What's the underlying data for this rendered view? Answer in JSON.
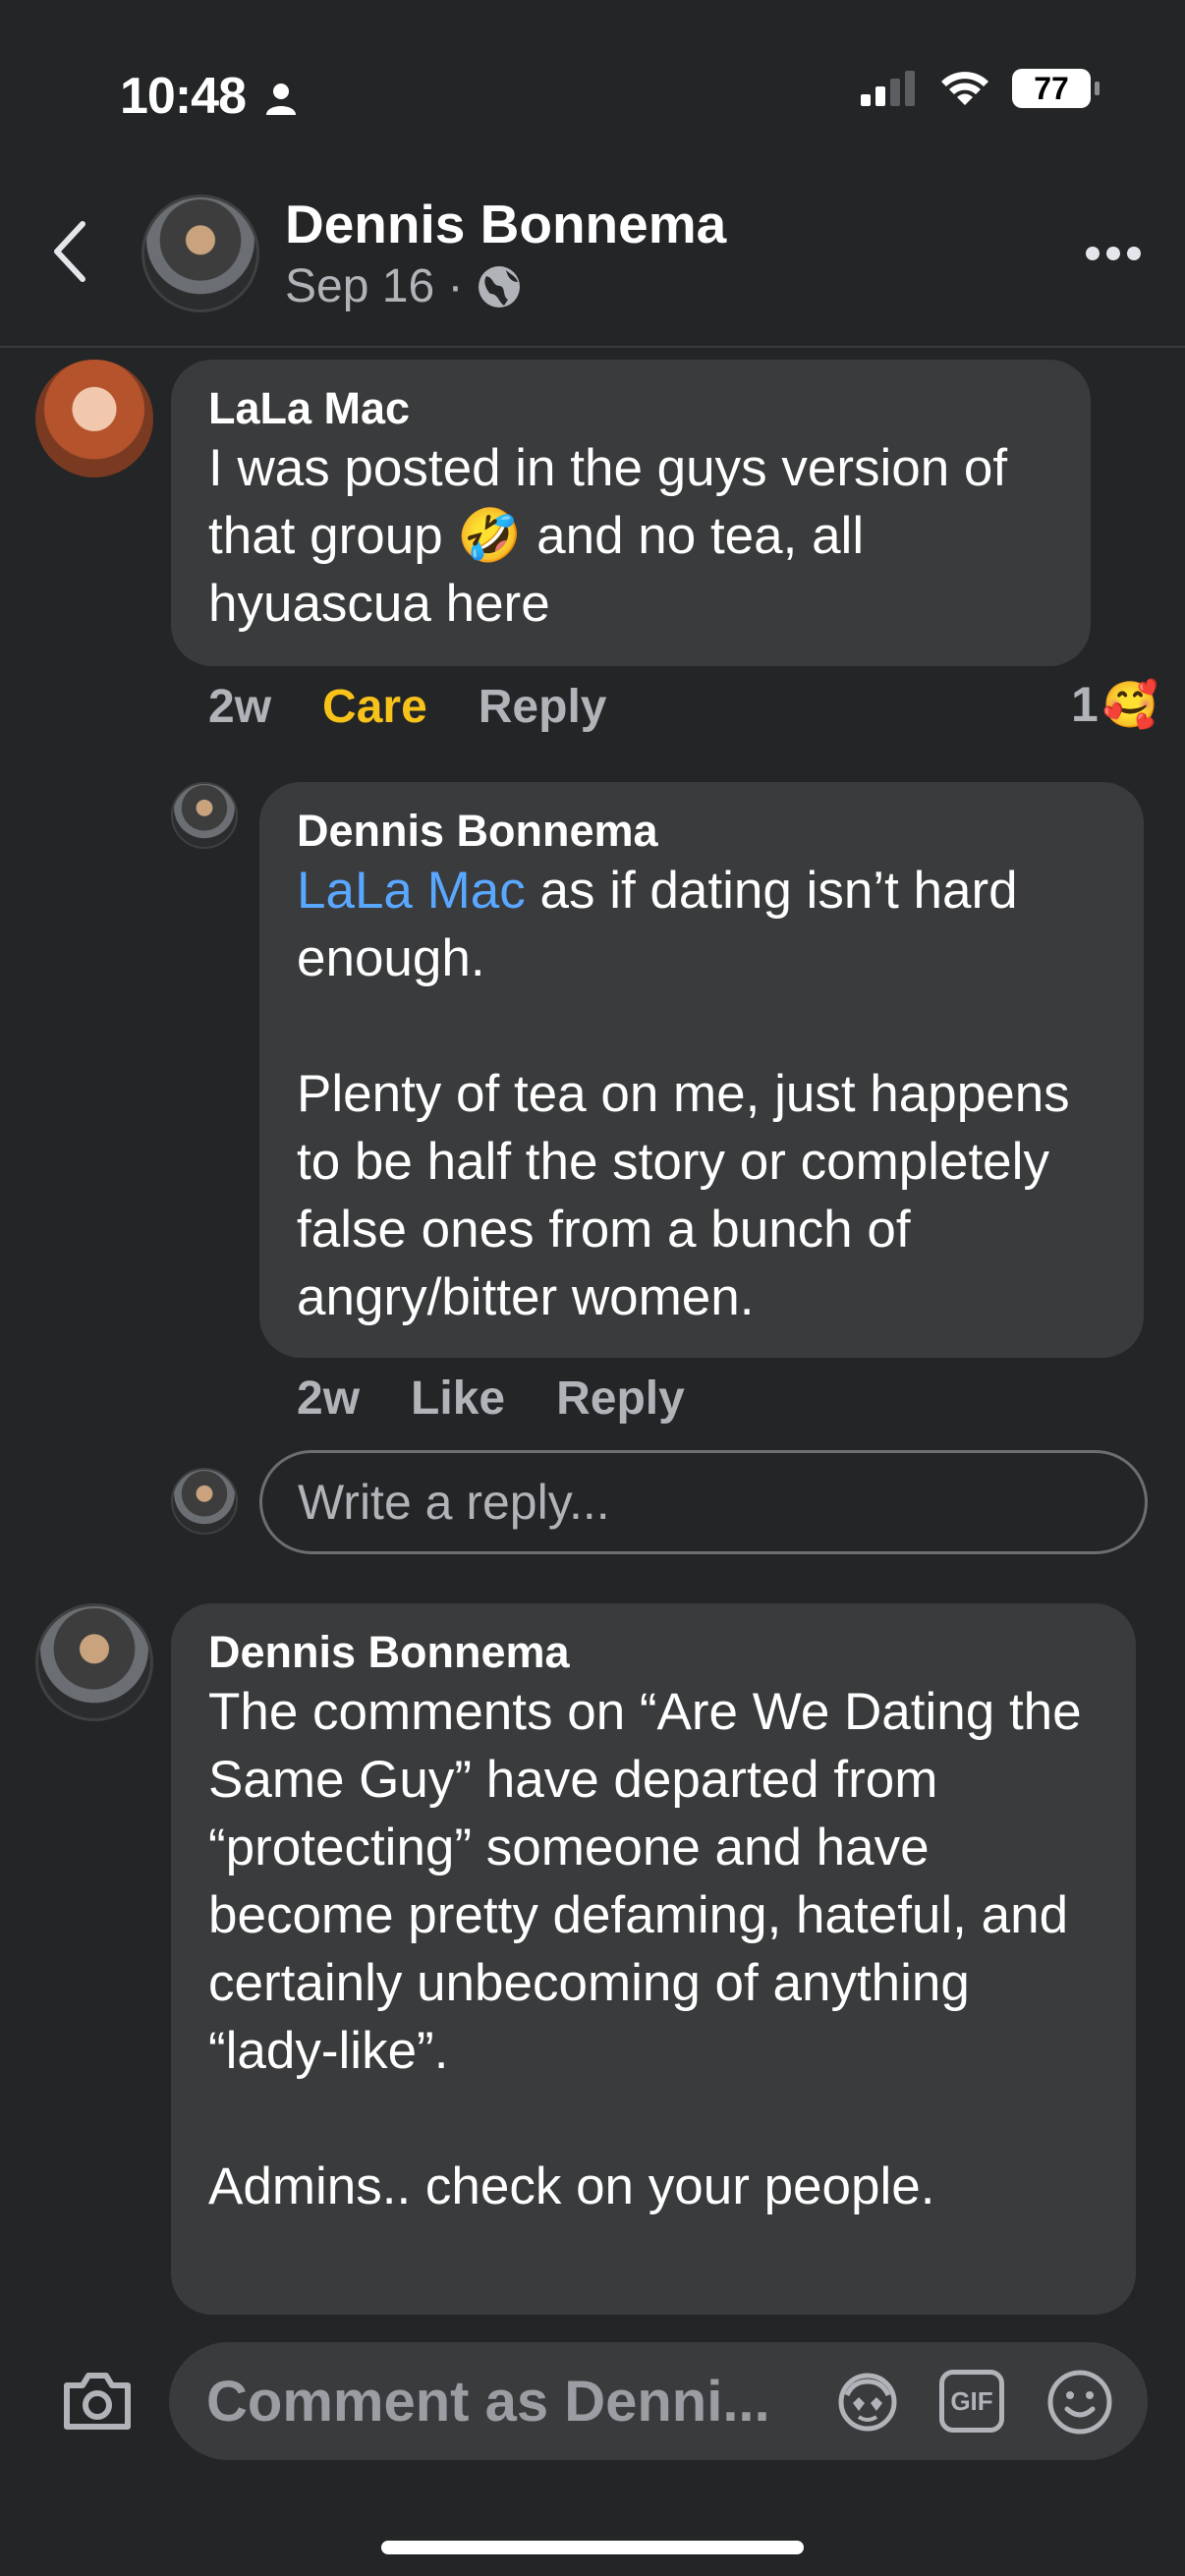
{
  "status_bar": {
    "time": "10:48",
    "battery": "77"
  },
  "header": {
    "name": "Dennis Bonnema",
    "date": "Sep 16 ·"
  },
  "comments": [
    {
      "author": "LaLa Mac",
      "text": "I was posted in the guys version of that group 🤣 and no tea, all hyuascua here",
      "time": "2w",
      "reaction_label": "Care",
      "reply_label": "Reply",
      "reaction_count": "1",
      "reaction_emoji": "🥰"
    },
    {
      "author": "Dennis Bonnema",
      "mention": "LaLa Mac",
      "text_after_mention": " as if dating isn’t hard enough.\n\nPlenty of tea on me, just happens to be half the story or completely false ones from a bunch of angry/bitter women.",
      "time": "2w",
      "like_label": "Like",
      "reply_label": "Reply"
    },
    {
      "author": "Dennis Bonnema",
      "text": "The comments on “Are We Dating the Same Guy” have departed from “protecting” someone and have become pretty defaming, hateful, and certainly unbecoming of anything “lady-like”.\n\nAdmins.. check on your people."
    }
  ],
  "reply_input": {
    "placeholder": "Write a reply..."
  },
  "comment_bar": {
    "placeholder": "Comment as Denni...",
    "gif_label": "GIF"
  }
}
